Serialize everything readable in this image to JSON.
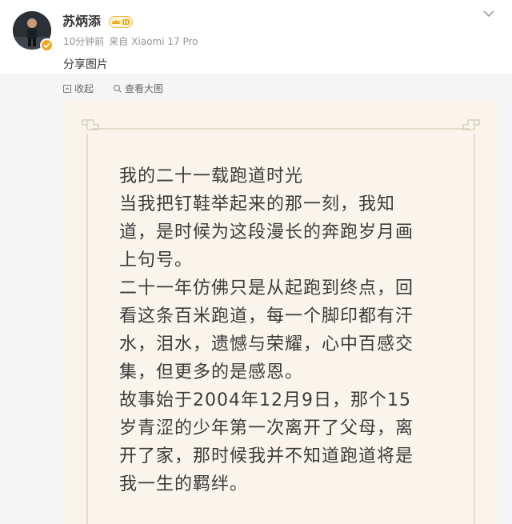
{
  "author": {
    "name": "苏炳添",
    "time": "10分钟前",
    "from_label": "来自",
    "device": "Xiaomi 17 Pro"
  },
  "post": {
    "text": "分享图片"
  },
  "toolbar": {
    "collapse_label": "收起",
    "view_large_label": "查看大图"
  },
  "image": {
    "lines": [
      "我的二十一载跑道时光",
      "当我把钉鞋举起来的那一刻，我知",
      "道，是时候为这段漫长的奔跑岁月画",
      "上句号。",
      "二十一年仿佛只是从起跑到终点，回",
      "看这条百米跑道，每一个脚印都有汗",
      "水，泪水，遗憾与荣耀，心中百感交",
      "集，但更多的是感恩。",
      "故事始于2004年12月9日，那个15",
      "岁青涩的少年第一次离开了父母，离",
      "开了家，那时候我并不知道跑道将是",
      "我一生的羁绊。"
    ]
  },
  "icons": {
    "more": "chevron-down-icon",
    "collapse": "collapse-icon",
    "view_large": "search-icon",
    "verified": "verified-icon",
    "vip": "vip-badge-icon"
  },
  "colors": {
    "name": "#333333",
    "meta": "#939393",
    "toolbar_bg": "#f5f5f5",
    "paper": "#f9f5ec",
    "frame_line": "#d7ccb5",
    "verified": "#f5a623"
  }
}
